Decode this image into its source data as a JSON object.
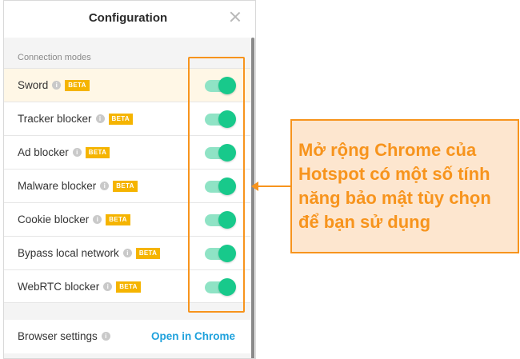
{
  "panel": {
    "title": "Configuration"
  },
  "section_label": "Connection modes",
  "rows": [
    {
      "label": "Sword",
      "badge": "BETA",
      "enabled": true,
      "active": true
    },
    {
      "label": "Tracker blocker",
      "badge": "BETA",
      "enabled": true
    },
    {
      "label": "Ad blocker",
      "badge": "BETA",
      "enabled": true
    },
    {
      "label": "Malware blocker",
      "badge": "BETA",
      "enabled": true
    },
    {
      "label": "Cookie blocker",
      "badge": "BETA",
      "enabled": true
    },
    {
      "label": "Bypass local network",
      "badge": "BETA",
      "enabled": true
    },
    {
      "label": "WebRTC blocker",
      "badge": "BETA",
      "enabled": true
    }
  ],
  "settings": {
    "label": "Browser settings",
    "link": "Open in Chrome"
  },
  "info_glyph": "i",
  "callout": {
    "text": "Mở rộng Chrome của Hotspot có một số tính năng bảo mật tùy chọn để bạn sử dụng"
  },
  "colors": {
    "accent_orange": "#f7941d",
    "toggle_green": "#18c98b",
    "link_blue": "#1ea1dc",
    "beta_yellow": "#f5b400"
  }
}
